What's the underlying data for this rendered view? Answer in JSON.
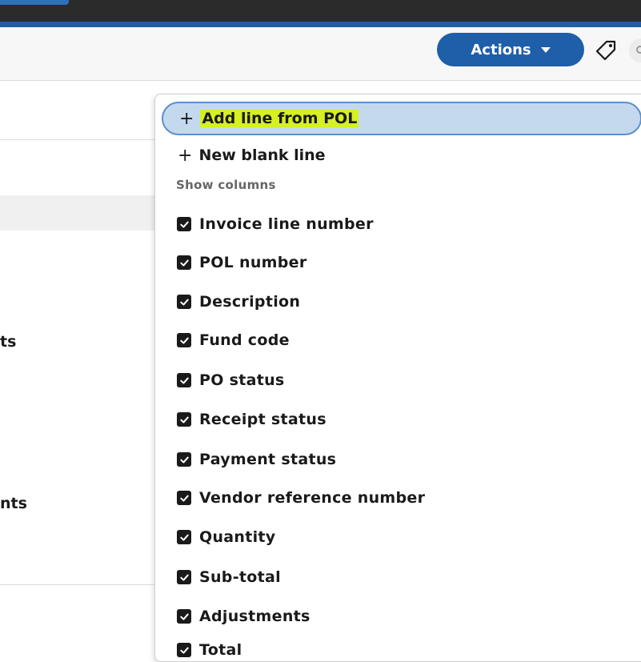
{
  "actions": {
    "label": "Actions"
  },
  "background": {
    "frag1": "ts",
    "frag2": "nts"
  },
  "menu": {
    "add_line": {
      "plus": "+",
      "label": "Add line from POL"
    },
    "new_line": {
      "plus": "+",
      "label": "New blank line"
    },
    "section_title": "Show columns",
    "columns": [
      {
        "label": "Invoice line number",
        "checked": true
      },
      {
        "label": "POL number",
        "checked": true
      },
      {
        "label": "Description",
        "checked": true
      },
      {
        "label": "Fund code",
        "checked": true
      },
      {
        "label": "PO status",
        "checked": true
      },
      {
        "label": "Receipt status",
        "checked": true
      },
      {
        "label": "Payment status",
        "checked": true
      },
      {
        "label": "Vendor reference number",
        "checked": true
      },
      {
        "label": "Quantity",
        "checked": true
      },
      {
        "label": "Sub-total",
        "checked": true
      },
      {
        "label": "Adjustments",
        "checked": true
      },
      {
        "label": "Total",
        "checked": true
      }
    ]
  },
  "colors": {
    "primary": "#1f5ea8",
    "highlight": "#d6f020",
    "active_bg": "#c5d9ee"
  }
}
